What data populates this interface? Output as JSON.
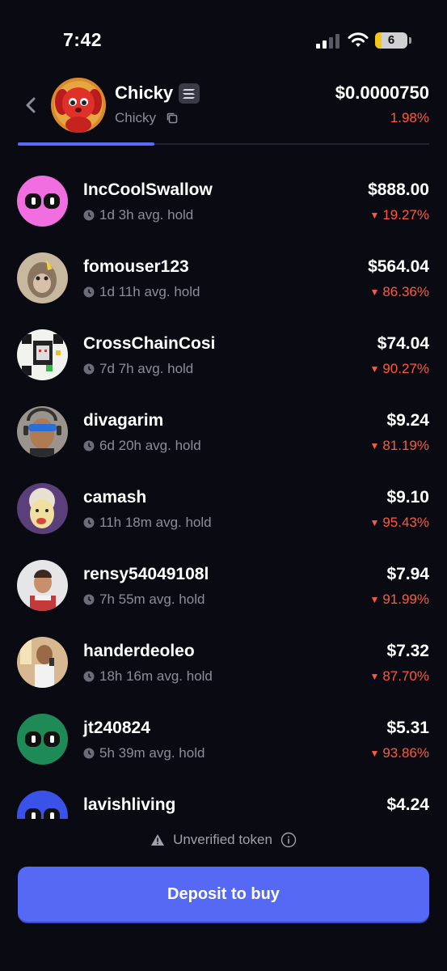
{
  "status_bar": {
    "time": "7:42",
    "battery": "6"
  },
  "token": {
    "name": "Chicky",
    "ticker": "Chicky",
    "price": "$0.0000750",
    "change": "1.98%"
  },
  "holders": [
    {
      "username": "IncCoolSwallow",
      "avg_hold": "1d 3h avg. hold",
      "value": "$888.00",
      "change": "19.27%"
    },
    {
      "username": "fomouser123",
      "avg_hold": "1d 11h avg. hold",
      "value": "$564.04",
      "change": "86.36%"
    },
    {
      "username": "CrossChainCosi",
      "avg_hold": "7d 7h avg. hold",
      "value": "$74.04",
      "change": "90.27%"
    },
    {
      "username": "divagarim",
      "avg_hold": "6d 20h avg. hold",
      "value": "$9.24",
      "change": "81.19%"
    },
    {
      "username": "camash",
      "avg_hold": "11h 18m avg. hold",
      "value": "$9.10",
      "change": "95.43%"
    },
    {
      "username": "rensy54049108l",
      "avg_hold": "7h 55m avg. hold",
      "value": "$7.94",
      "change": "91.99%"
    },
    {
      "username": "handerdeoleo",
      "avg_hold": "18h 16m avg. hold",
      "value": "$7.32",
      "change": "87.70%"
    },
    {
      "username": "jt240824",
      "avg_hold": "5h 39m avg. hold",
      "value": "$5.31",
      "change": "93.86%"
    },
    {
      "username": "lavishliving",
      "avg_hold": "",
      "value": "$4.24",
      "change": ""
    }
  ],
  "footer": {
    "unverified_label": "Unverified token",
    "deposit_label": "Deposit to buy"
  },
  "colors": {
    "accent": "#5669f5",
    "negative": "#ff5a3c",
    "background": "#0a0a12"
  }
}
